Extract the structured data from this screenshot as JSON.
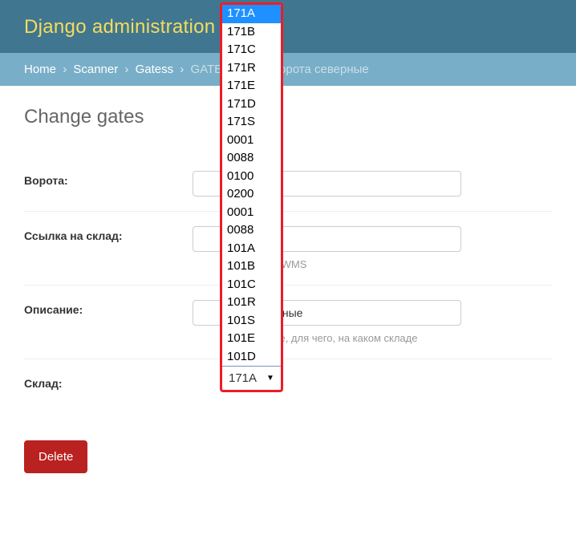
{
  "header": {
    "title": "Django administration"
  },
  "breadcrumbs": {
    "home": "Home",
    "app": "Scanner",
    "model": "Gatess",
    "current_prefix": "GATES",
    "current_mid": "171A",
    "current_suffix": ": Ворота северные"
  },
  "page": {
    "heading": "Change gates"
  },
  "form": {
    "vorota": {
      "label": "Ворота:",
      "value": ""
    },
    "link_sklad": {
      "label": "Ссылка на склад:",
      "value": "",
      "help_suffix": "адов WMS"
    },
    "opisanie": {
      "label": "Описание:",
      "value_visible_tail": "верные",
      "help_suffix": "от, где, для чего, на каком складе"
    },
    "sklad": {
      "label": "Склад:",
      "selected": "171A",
      "options": [
        "171A",
        "171B",
        "171C",
        "171R",
        "171E",
        "171D",
        "171S",
        "0001",
        "0088",
        "0100",
        "0200",
        "0001",
        "0088",
        "101A",
        "101B",
        "101C",
        "101R",
        "101S",
        "101E",
        "101D"
      ]
    }
  },
  "actions": {
    "delete": "Delete"
  }
}
